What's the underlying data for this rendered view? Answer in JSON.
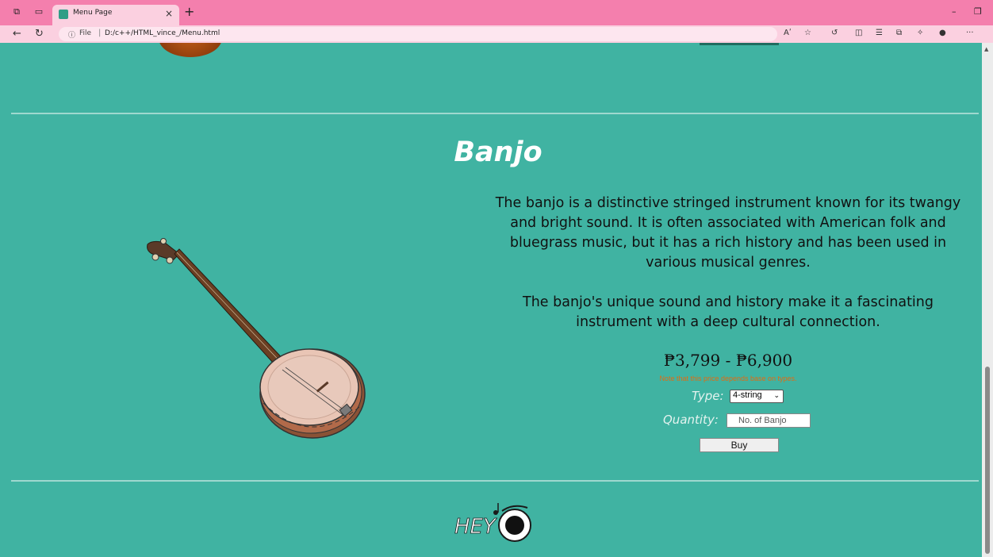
{
  "browser": {
    "tab_title": "Menu Page",
    "tab_close": "×",
    "new_tab": "+",
    "url_info_icon": "ⓘ",
    "url_file_label": "File",
    "url": "D:/c++/HTML_vince_/Menu.html",
    "read_aloud_label": "Aʹ",
    "more_label": "···"
  },
  "previous_section": {
    "image": "guitar-image"
  },
  "product": {
    "title": "Banjo",
    "description_1": "The banjo is a distinctive stringed instrument known for its twangy and bright sound. It is often associated with American folk and bluegrass music, but it has a rich history and has been used in various musical genres.",
    "description_2": "The banjo's unique sound and history make it a fascinating instrument with a deep cultural connection.",
    "price": "₱3,799 - ₱6,900",
    "price_note": "Note that this price depends base on types.",
    "type_label": "Type:",
    "type_selected": "4-string",
    "quantity_label": "Quantity:",
    "quantity_placeholder": "No. of Banjo",
    "buy_label": "Buy"
  },
  "footer": {
    "logo_text": "HEY"
  },
  "colors": {
    "page_bg": "#40b3a2",
    "tabbar_bg": "#f47fad",
    "addrbar_bg": "#fbd0e0",
    "note_color": "#e06c12"
  }
}
